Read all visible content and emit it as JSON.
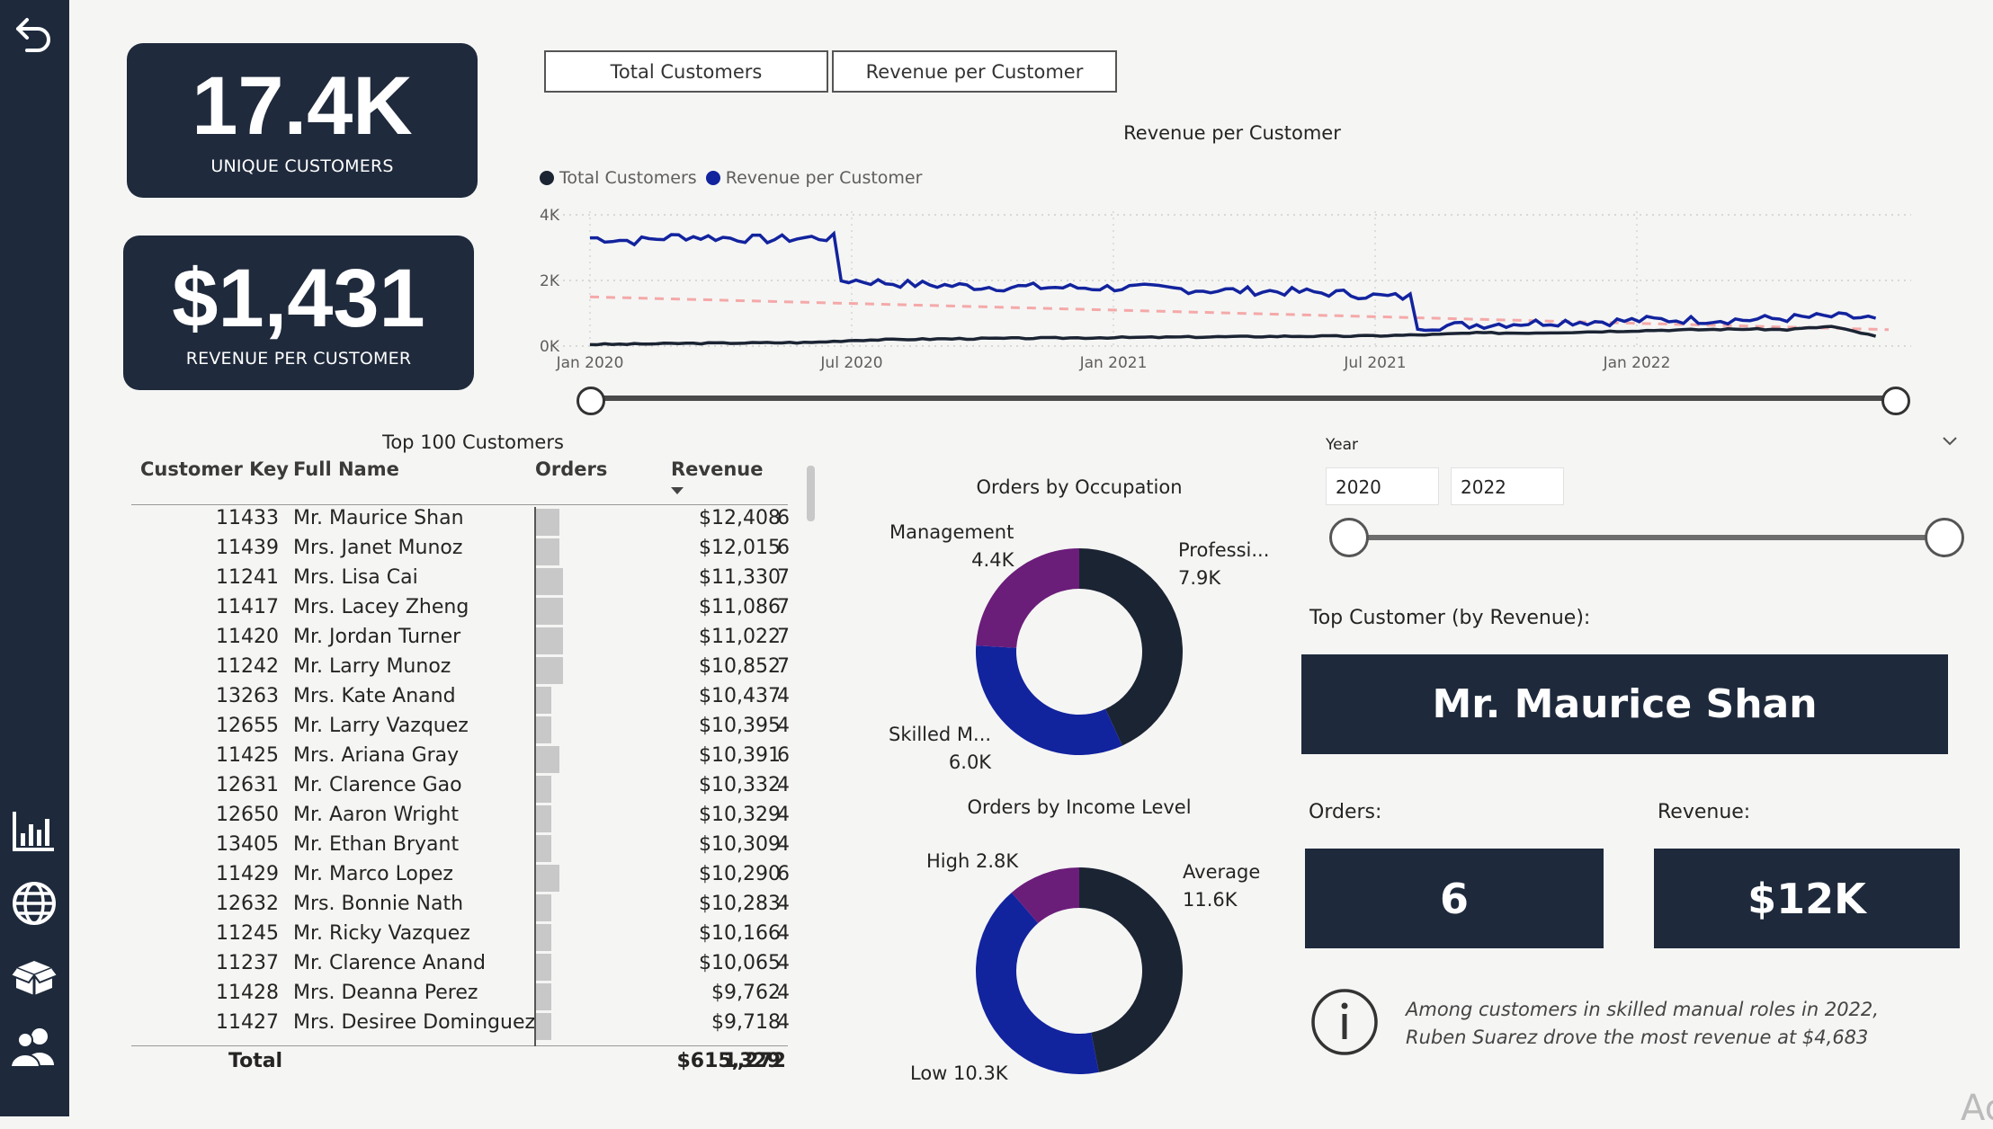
{
  "colors": {
    "navy": "#1e2a3c",
    "dark_series": "#1b2433",
    "blue_series": "#12239e",
    "purple": "#6b1d7a",
    "trend": "#f4a9a8"
  },
  "nav": {
    "icons": [
      "back-arrow-icon",
      "bar-chart-icon",
      "globe-icon",
      "box-icon",
      "users-icon"
    ]
  },
  "kpi": {
    "customers": {
      "value": "17.4K",
      "label": "UNIQUE CUSTOMERS"
    },
    "revenue": {
      "value": "$1,431",
      "label": "REVENUE PER CUSTOMER"
    }
  },
  "toggle": {
    "left": "Total Customers",
    "right": "Revenue per Customer"
  },
  "line_chart": {
    "title": "Revenue per Customer",
    "legend": [
      "Total Customers",
      "Revenue per Customer"
    ],
    "y_ticks": [
      "4K",
      "2K",
      "0K"
    ],
    "x_ticks": [
      "Jan 2020",
      "Jul 2020",
      "Jan 2021",
      "Jul 2021",
      "Jan 2022"
    ]
  },
  "chart_data": [
    {
      "type": "line",
      "title": "Revenue per Customer",
      "x": [
        "2020-01",
        "2020-02",
        "2020-03",
        "2020-04",
        "2020-05",
        "2020-06",
        "2020-07",
        "2020-08",
        "2020-09",
        "2020-10",
        "2020-11",
        "2020-12",
        "2021-01",
        "2021-02",
        "2021-03",
        "2021-04",
        "2021-05",
        "2021-06",
        "2021-07",
        "2021-08",
        "2021-09",
        "2021-10",
        "2021-11",
        "2021-12",
        "2022-01",
        "2022-02",
        "2022-03",
        "2022-04",
        "2022-05",
        "2022-06"
      ],
      "series": [
        {
          "name": "Revenue per Customer",
          "values": [
            3300,
            3200,
            3350,
            3300,
            3250,
            3300,
            2000,
            1900,
            1850,
            1800,
            1800,
            1780,
            1780,
            1750,
            1700,
            1680,
            1650,
            1600,
            1500,
            600,
            650,
            700,
            750,
            750,
            800,
            800,
            800,
            850,
            900,
            850
          ]
        },
        {
          "name": "Total Customers",
          "values": [
            50,
            60,
            80,
            90,
            100,
            110,
            180,
            200,
            220,
            230,
            240,
            250,
            260,
            270,
            280,
            290,
            300,
            300,
            320,
            350,
            400,
            400,
            420,
            450,
            480,
            500,
            520,
            500,
            600,
            300
          ]
        }
      ],
      "ylim": [
        0,
        4000
      ],
      "trend": {
        "start": 1500,
        "end": 500
      }
    },
    {
      "type": "pie",
      "title": "Orders by Occupation",
      "labels": [
        "Professi...",
        "Skilled M...",
        "Management"
      ],
      "values": [
        7.9,
        6.0,
        4.4
      ],
      "value_labels": [
        "7.9K",
        "6.0K",
        "4.4K"
      ]
    },
    {
      "type": "pie",
      "title": "Orders by Income Level",
      "labels": [
        "Average",
        "Low",
        "High"
      ],
      "values": [
        11.6,
        10.3,
        2.8
      ],
      "value_labels": [
        "11.6K",
        "10.3K",
        "2.8K"
      ]
    }
  ],
  "table": {
    "title": "Top 100 Customers",
    "headers": {
      "key": "Customer Key",
      "name": "Full Name",
      "orders": "Orders",
      "revenue": "Revenue"
    },
    "rows": [
      {
        "key": "11433",
        "name": "Mr. Maurice Shan",
        "orders": 6,
        "revenue": "$12,408"
      },
      {
        "key": "11439",
        "name": "Mrs. Janet Munoz",
        "orders": 6,
        "revenue": "$12,015"
      },
      {
        "key": "11241",
        "name": "Mrs. Lisa Cai",
        "orders": 7,
        "revenue": "$11,330"
      },
      {
        "key": "11417",
        "name": "Mrs. Lacey Zheng",
        "orders": 7,
        "revenue": "$11,086"
      },
      {
        "key": "11420",
        "name": "Mr. Jordan Turner",
        "orders": 7,
        "revenue": "$11,022"
      },
      {
        "key": "11242",
        "name": "Mr. Larry Munoz",
        "orders": 7,
        "revenue": "$10,852"
      },
      {
        "key": "13263",
        "name": "Mrs. Kate Anand",
        "orders": 4,
        "revenue": "$10,437"
      },
      {
        "key": "12655",
        "name": "Mr. Larry Vazquez",
        "orders": 4,
        "revenue": "$10,395"
      },
      {
        "key": "11425",
        "name": "Mrs. Ariana Gray",
        "orders": 6,
        "revenue": "$10,391"
      },
      {
        "key": "12631",
        "name": "Mr. Clarence Gao",
        "orders": 4,
        "revenue": "$10,332"
      },
      {
        "key": "12650",
        "name": "Mr. Aaron Wright",
        "orders": 4,
        "revenue": "$10,329"
      },
      {
        "key": "13405",
        "name": "Mr. Ethan Bryant",
        "orders": 4,
        "revenue": "$10,309"
      },
      {
        "key": "11429",
        "name": "Mr. Marco Lopez",
        "orders": 6,
        "revenue": "$10,290"
      },
      {
        "key": "12632",
        "name": "Mrs. Bonnie Nath",
        "orders": 4,
        "revenue": "$10,283"
      },
      {
        "key": "11245",
        "name": "Mr. Ricky Vazquez",
        "orders": 4,
        "revenue": "$10,166"
      },
      {
        "key": "11237",
        "name": "Mr. Clarence Anand",
        "orders": 4,
        "revenue": "$10,065"
      },
      {
        "key": "11428",
        "name": "Mrs. Deanna Perez",
        "orders": 4,
        "revenue": "$9,762"
      },
      {
        "key": "11427",
        "name": "Mrs. Desiree Dominguez",
        "orders": 4,
        "revenue": "$9,718"
      }
    ],
    "total": {
      "label": "Total",
      "orders": "1,272",
      "revenue": "$615,329"
    }
  },
  "slicer": {
    "title": "Year",
    "from": "2020",
    "to": "2022"
  },
  "top_customer": {
    "label": "Top Customer (by Revenue):",
    "name": "Mr. Maurice Shan",
    "orders_label": "Orders:",
    "orders": "6",
    "revenue_label": "Revenue:",
    "revenue": "$12K"
  },
  "insight": {
    "text": "Among customers in skilled manual roles in 2022, Ruben Suarez drove the most revenue at $4,683"
  },
  "watermark": "Ac"
}
